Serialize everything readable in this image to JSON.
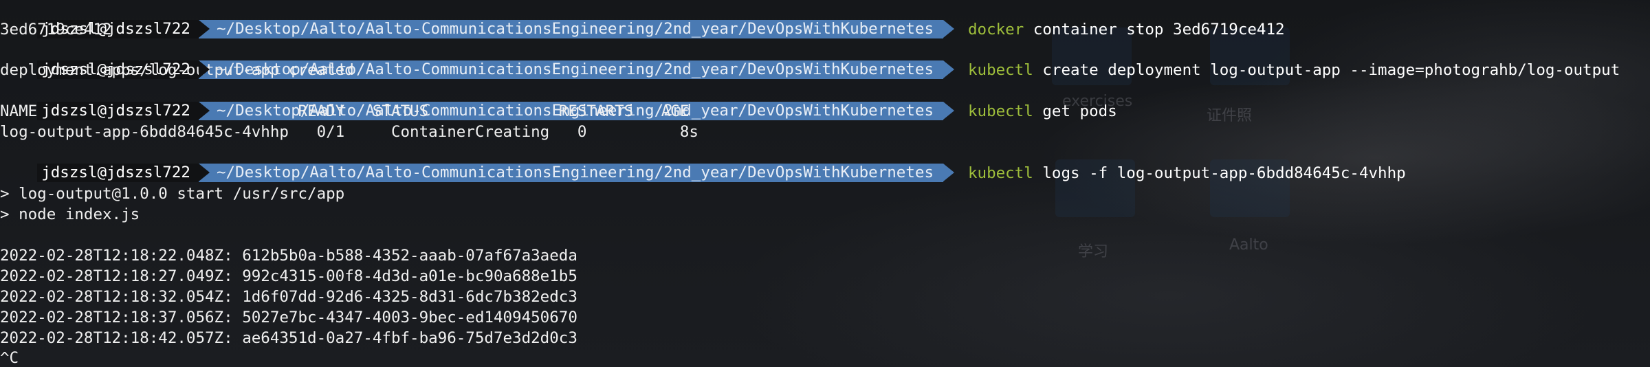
{
  "desktop_labels": [
    "exercises",
    "证件照",
    "学习",
    "Aalto"
  ],
  "prompt": {
    "user_host": "jdszsl@jdszsl722",
    "path": "~/Desktop/Aalto/Aalto-CommunicationsEngineering/2nd_year/DevOpsWithKubernetes"
  },
  "commands": [
    {
      "name": "docker",
      "args": " container stop 3ed6719ce412"
    },
    {
      "name": "kubectl",
      "args": " create deployment log-output-app --image=photograhb/log-output"
    },
    {
      "name": "kubectl",
      "args": " get pods"
    },
    {
      "name": "kubectl",
      "args": " logs -f log-output-app-6bdd84645c-4vhhp"
    }
  ],
  "outputs": {
    "stop_result": "3ed6719ce412",
    "deploy_result": "deployment.apps/log-output-app created",
    "pods_header": "NAME                            READY   STATUS              RESTARTS   AGE",
    "pods_row": "log-output-app-6bdd84645c-4vhhp   0/1     ContainerCreating   0          8s",
    "npm_start": "> log-output@1.0.0 start /usr/src/app",
    "npm_node": "> node index.js",
    "log_lines": [
      "2022-02-28T12:18:22.048Z: 612b5b0a-b588-4352-aaab-07af67a3aeda",
      "2022-02-28T12:18:27.049Z: 992c4315-00f8-4d3d-a01e-bc90a688e1b5",
      "2022-02-28T12:18:32.054Z: 1d6f07dd-92d6-4325-8d31-6dc7b382edc3",
      "2022-02-28T12:18:37.056Z: 5027e7bc-4347-4003-9bec-ed1409450670",
      "2022-02-28T12:18:42.057Z: ae64351d-0a27-4fbf-ba96-75d7e3d2d0c3"
    ],
    "interrupt": "^C"
  },
  "colors": {
    "background": "#17191c",
    "user_segment": "#111214",
    "path_segment": "#4a7ab3",
    "command": "#9fbf3b",
    "text": "#f0f0f0"
  }
}
